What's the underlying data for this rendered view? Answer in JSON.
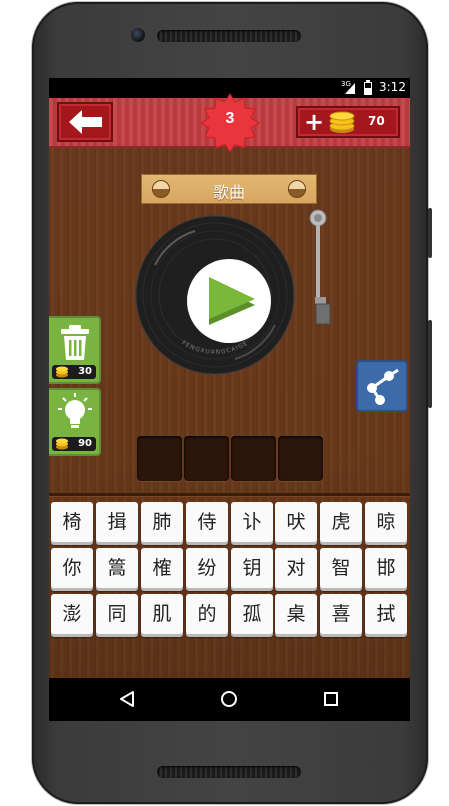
{
  "status_bar": {
    "network": "3G",
    "time": "3:12"
  },
  "header": {
    "level": "3",
    "coins": "70"
  },
  "category": {
    "label": "歌曲"
  },
  "powerups": {
    "remove_cost": "30",
    "hint_cost": "90"
  },
  "record": {
    "label_text": "FENGXUANGCAIGE"
  },
  "answer_slots": [
    "",
    "",
    "",
    ""
  ],
  "keyboard": [
    [
      "椅",
      "揖",
      "肺",
      "侍",
      "讣",
      "吠",
      "虎",
      "晾"
    ],
    [
      "你",
      "篙",
      "榷",
      "纷",
      "钥",
      "对",
      "智",
      "邯"
    ],
    [
      "澎",
      "同",
      "肌",
      "的",
      "孤",
      "桌",
      "喜",
      "拭"
    ]
  ],
  "colors": {
    "header_red": "#b63a3e",
    "button_red": "#a3171d",
    "badge_red": "#e8363c",
    "wood_brown": "#6b3a1e",
    "powerup_green": "#79b443",
    "share_blue": "#3d6aa8",
    "play_green": "#7ab83a"
  },
  "icons": [
    "back-arrow-icon",
    "plus-icon",
    "coin-stack-icon",
    "trash-icon",
    "lightbulb-icon",
    "share-icon",
    "play-icon",
    "nav-back-icon",
    "nav-home-icon",
    "nav-recents-icon"
  ]
}
